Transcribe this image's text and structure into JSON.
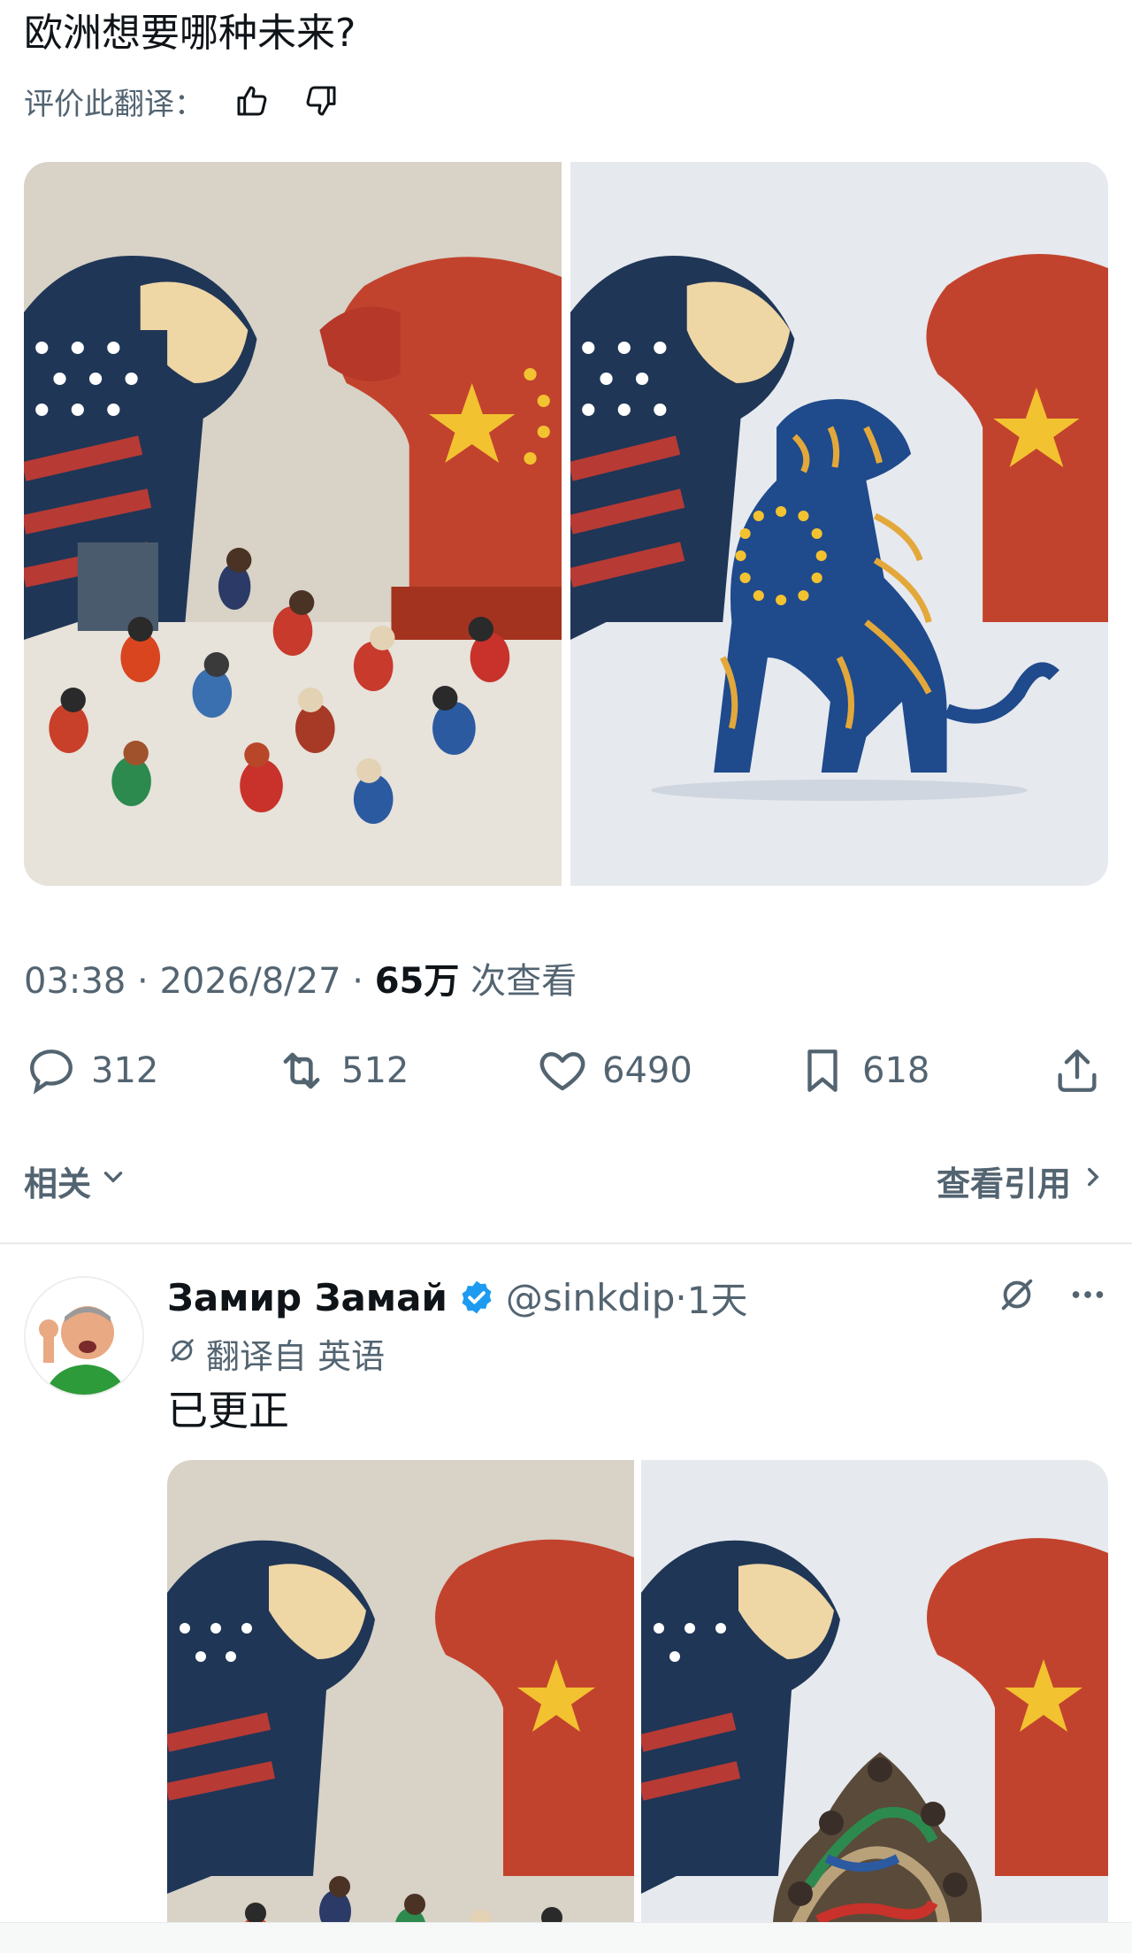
{
  "tweet": {
    "text": "欧洲想要哪种未来?",
    "rate_label": "评价此翻译：",
    "time": "03:38",
    "date": "2026/8/27",
    "views_count": "65万",
    "views_label": "次查看"
  },
  "actions": {
    "replies": "312",
    "retweets": "512",
    "likes": "6490",
    "bookmarks": "618"
  },
  "related": {
    "left_label": "相关",
    "right_label": "查看引用"
  },
  "reply": {
    "name": "Замир Замай",
    "handle": "@sinkdip",
    "time": "1天",
    "translated_label": "翻译自 英语",
    "text": "已更正"
  },
  "colors": {
    "text_primary": "#0f1419",
    "text_secondary": "#536471",
    "verified_blue": "#1d9bf0",
    "divider": "#e7e9ea"
  },
  "icons": [
    "thumbs-up-icon",
    "thumbs-down-icon",
    "reply-icon",
    "retweet-icon",
    "like-icon",
    "bookmark-icon",
    "share-icon",
    "chevron-down-icon",
    "chevron-right-icon",
    "verified-icon",
    "translate-icon",
    "more-icon"
  ]
}
